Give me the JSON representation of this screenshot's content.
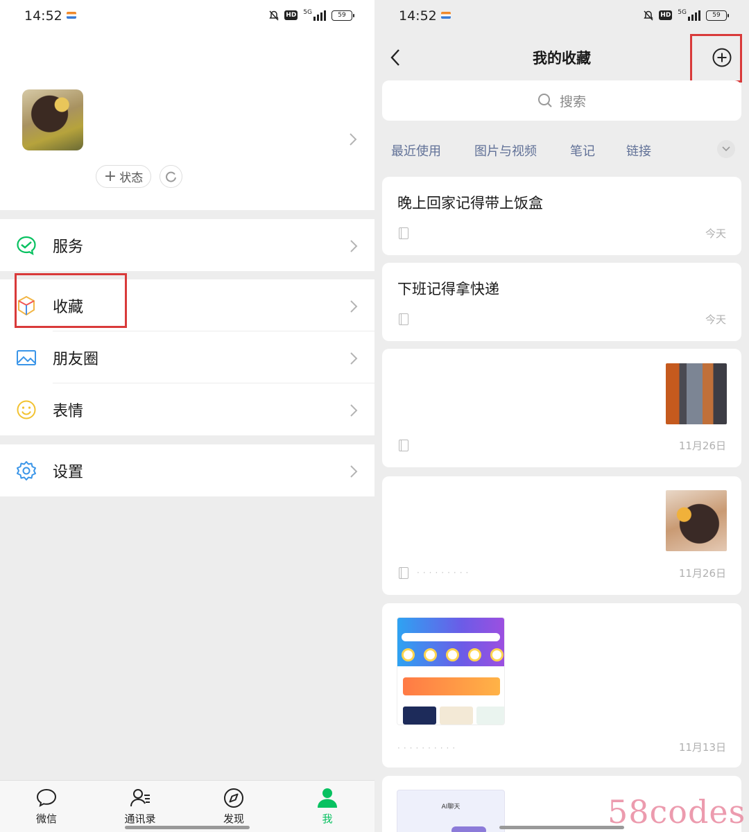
{
  "status_bar": {
    "time": "14:52",
    "battery": "59",
    "hd": "HD",
    "network": "5G"
  },
  "left": {
    "status_button": "状态",
    "menu": [
      {
        "label": "服务",
        "icon": "service-icon"
      },
      {
        "label": "收藏",
        "icon": "favorites-cube-icon"
      },
      {
        "label": "朋友圈",
        "icon": "moments-picture-icon"
      },
      {
        "label": "表情",
        "icon": "sticker-smiley-icon"
      },
      {
        "label": "设置",
        "icon": "settings-gear-icon"
      }
    ],
    "tabs": [
      {
        "label": "微信",
        "icon": "chat-bubble-icon",
        "active": false
      },
      {
        "label": "通讯录",
        "icon": "contacts-icon",
        "active": false
      },
      {
        "label": "发现",
        "icon": "compass-icon",
        "active": false
      },
      {
        "label": "我",
        "icon": "person-icon",
        "active": true
      }
    ],
    "accent_color": "#07c160",
    "highlight_color": "#d93a3a"
  },
  "right": {
    "title": "我的收藏",
    "search_placeholder": "搜索",
    "filters": [
      "最近使用",
      "图片与视频",
      "笔记",
      "链接"
    ],
    "cards": [
      {
        "title": "晚上回家记得带上饭盒",
        "date": "今天"
      },
      {
        "title": "下班记得拿快递",
        "date": "今天"
      },
      {
        "title": "",
        "date": "11月26日"
      },
      {
        "title": "",
        "date": "11月26日"
      },
      {
        "title": "",
        "date": "11月13日"
      },
      {
        "title": "",
        "screenshot_title": "AI聊天"
      }
    ]
  },
  "watermark": "58codes"
}
